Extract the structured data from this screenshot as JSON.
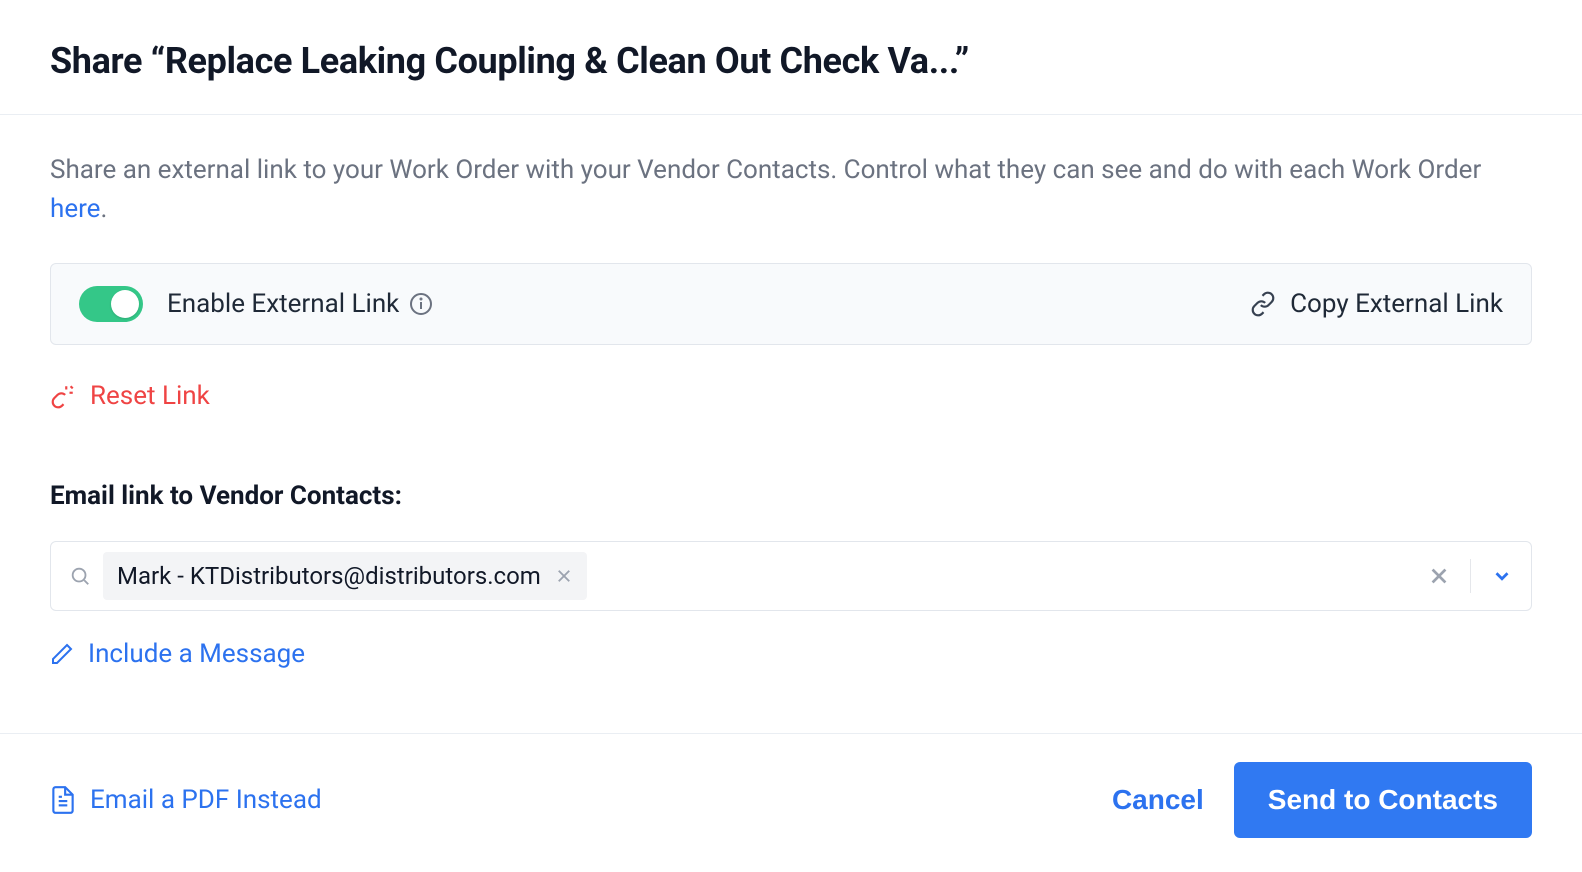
{
  "header": {
    "title": "Share “Replace Leaking Coupling & Clean Out Check Va...”"
  },
  "intro": {
    "text_before": "Share an external link to your Work Order with your Vendor Contacts. Control what they can see and do with each Work Order ",
    "link_text": "here",
    "text_after": "."
  },
  "enable_box": {
    "toggle_on": true,
    "label": "Enable External Link",
    "copy_label": "Copy External Link"
  },
  "reset": {
    "label": "Reset Link"
  },
  "email_section": {
    "label": "Email link to Vendor Contacts:",
    "chip": "Mark - KTDistributors@distributors.com"
  },
  "include_message": {
    "label": "Include a Message"
  },
  "footer": {
    "pdf_label": "Email a PDF Instead",
    "cancel_label": "Cancel",
    "send_label": "Send to Contacts"
  }
}
